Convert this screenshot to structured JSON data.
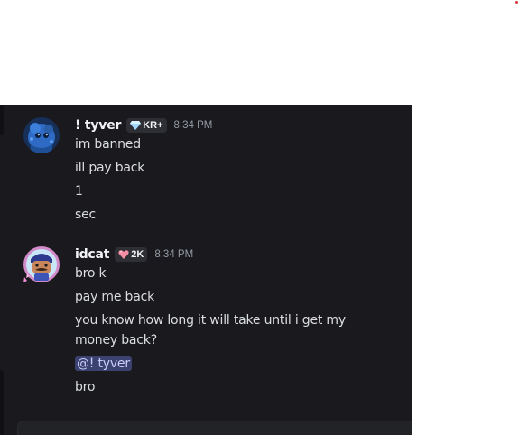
{
  "messages": [
    {
      "username": "! tyver",
      "tag": "KR+",
      "tag_icon": "gem-icon",
      "timestamp": "8:34 PM",
      "lines": [
        "im banned",
        "ill pay back",
        "1",
        "sec"
      ]
    },
    {
      "username": "idcat",
      "tag": "2K",
      "tag_icon": "heart-gem-icon",
      "timestamp": "8:34 PM",
      "lines": [
        "bro k",
        "pay me back",
        "you know how long it will take until i get my money back?"
      ],
      "mention": "@! tyver",
      "last_line": "bro"
    }
  ],
  "colors": {
    "background": "#1a1a1e",
    "username": "#f2f3f5",
    "text": "#dbdee1",
    "timestamp": "#949ba4",
    "mention_bg": "#3c4270",
    "mention_text": "#c9cdfb"
  }
}
